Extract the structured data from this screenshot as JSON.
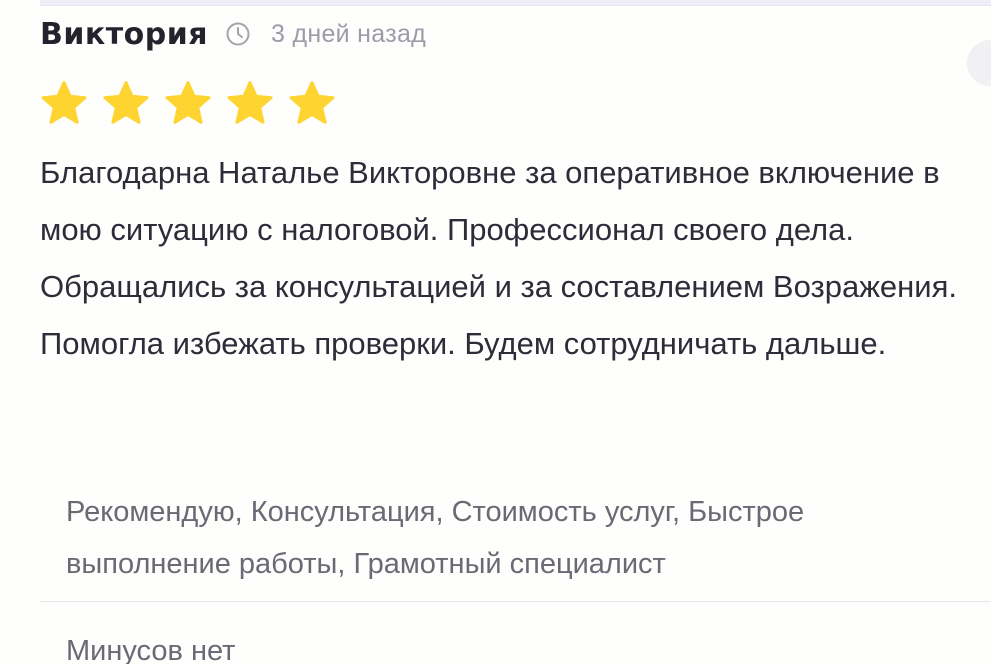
{
  "review": {
    "author": "Виктория",
    "time_icon": "clock-icon",
    "time_ago": "3 дней назад",
    "rating": 5,
    "rating_max": 5,
    "star_icon": "star-icon",
    "star_color": "#fdd430",
    "text": "Благодарна Наталье Викторовне за оперативное включение в мою ситуацию с налоговой. Профессионал своего дела. Обращались за консультацией и за составлением Возражения. Помогла избежать проверки. Будем сотрудничать дальше.",
    "pros": "Рекомендую, Консультация, Стоимость услуг, Быстрое выполнение работы, Грамотный специалист",
    "cons": "Минусов нет"
  }
}
